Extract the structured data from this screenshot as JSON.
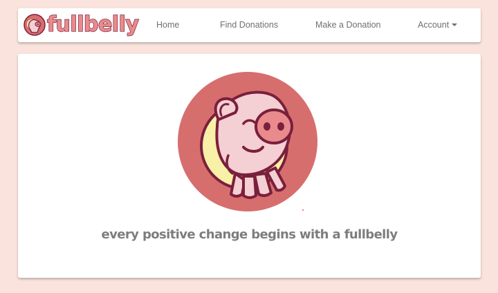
{
  "brand": {
    "name": "fullbelly",
    "logo_icon": "pig-face-icon"
  },
  "nav": {
    "home_label": "Home",
    "find_label": "Find Donations",
    "make_label": "Make a Donation",
    "account_label": "Account"
  },
  "hero": {
    "image_icon": "pig-mascot-illustration",
    "tagline": "every positive change begins with a fullbelly"
  },
  "colors": {
    "page_background": "#f9e3dc",
    "brand_fill": "#e98b8c",
    "brand_outline": "#7a1f3c",
    "mascot_circle": "#d76e6e",
    "mascot_body": "#f4cfd3",
    "mascot_highlight": "#f8f0a6",
    "text_muted": "#7d7d7d"
  }
}
